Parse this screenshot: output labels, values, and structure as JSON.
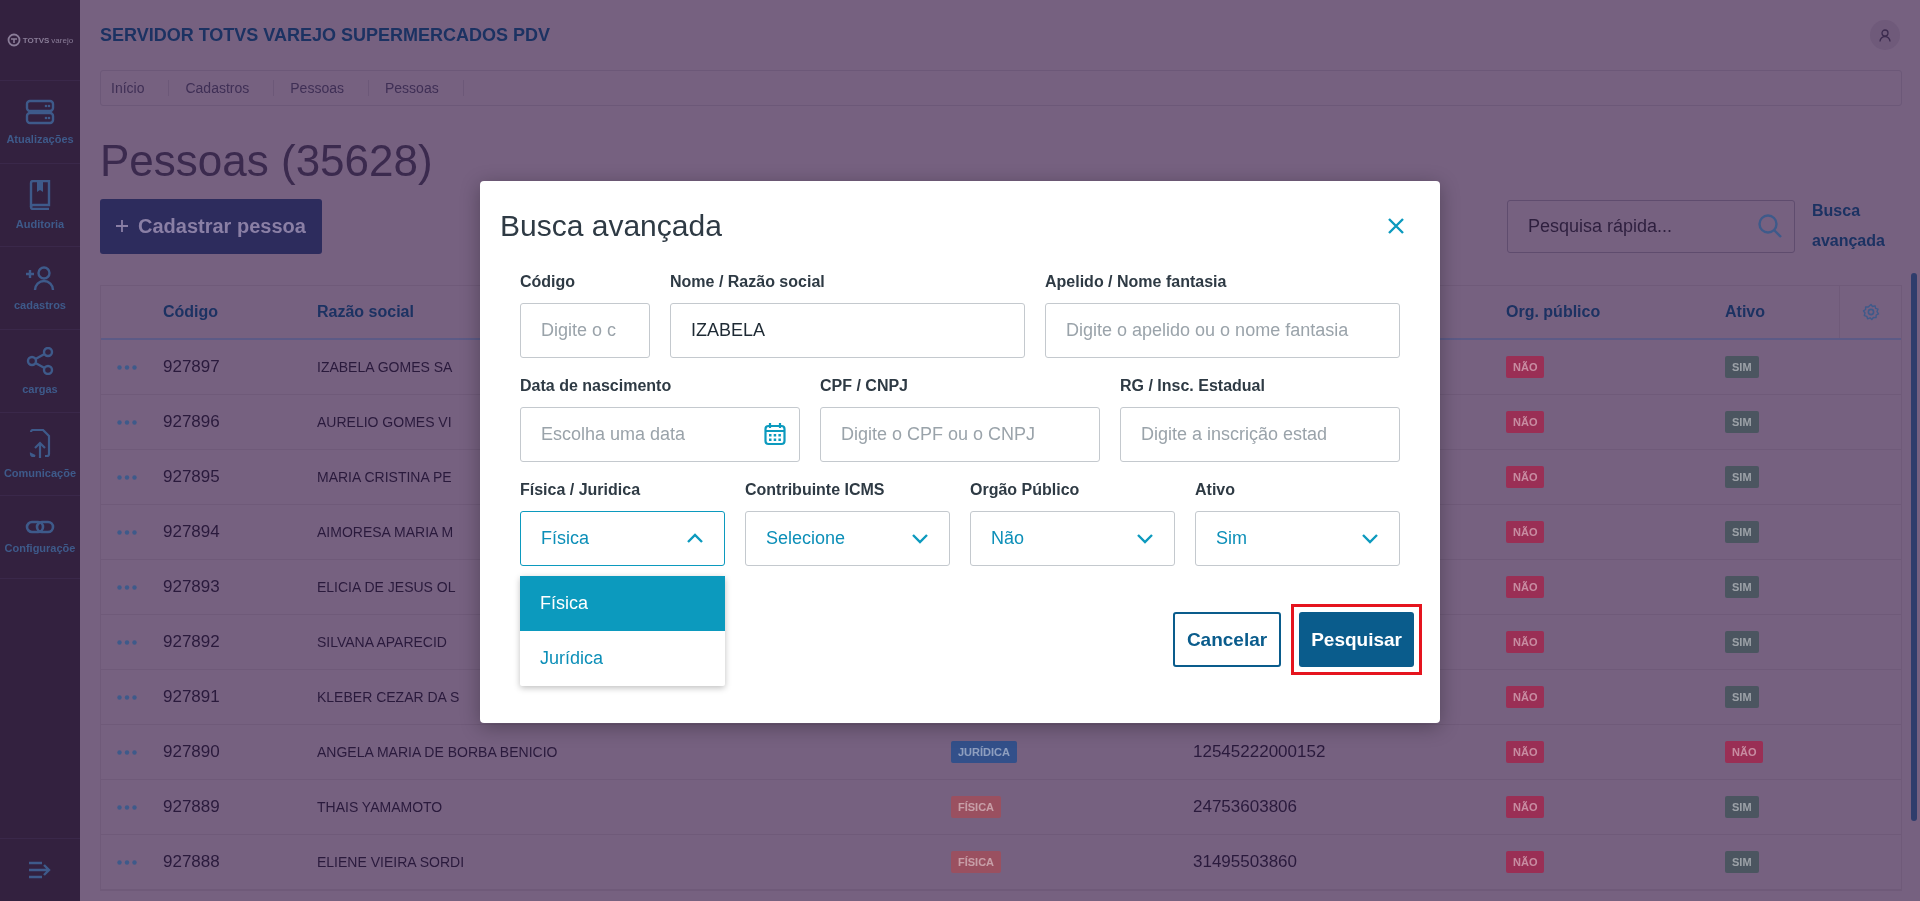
{
  "sidebar": {
    "logo": {
      "brand": "TOTVS",
      "sub": "varejo"
    },
    "items": [
      {
        "label": "Atualizações"
      },
      {
        "label": "Auditoria"
      },
      {
        "label": "cadastros"
      },
      {
        "label": "cargas"
      },
      {
        "label": "Comunicaçõe"
      },
      {
        "label": "Configuraçõe"
      }
    ]
  },
  "header": {
    "title": "SERVIDOR TOTVS VAREJO SUPERMERCADOS PDV"
  },
  "breadcrumb": [
    "Início",
    "Cadastros",
    "Pessoas",
    "Pessoas"
  ],
  "page_title": "Pessoas (35628)",
  "new_button": {
    "label": "Cadastrar pessoa"
  },
  "quick_search": {
    "placeholder": "Pesquisa rápida..."
  },
  "advanced_link": "Busca avançada",
  "table": {
    "columns": [
      "Código",
      "Razão social",
      "Org. público",
      "Ativo"
    ],
    "rows": [
      {
        "code": "927897",
        "name": "IZABELA GOMES SA",
        "org_publico": {
          "label": "NÃO",
          "color": "#9a2f55"
        },
        "ativo": {
          "label": "SIM",
          "color": "#4b5560"
        }
      },
      {
        "code": "927896",
        "name": "AURELIO GOMES VI",
        "org_publico": {
          "label": "NÃO",
          "color": "#9a2f55"
        },
        "ativo": {
          "label": "SIM",
          "color": "#4b5560"
        }
      },
      {
        "code": "927895",
        "name": "MARIA CRISTINA PE",
        "org_publico": {
          "label": "NÃO",
          "color": "#9a2f55"
        },
        "ativo": {
          "label": "SIM",
          "color": "#4b5560"
        }
      },
      {
        "code": "927894",
        "name": "AIMORESA MARIA M",
        "org_publico": {
          "label": "NÃO",
          "color": "#9a2f55"
        },
        "ativo": {
          "label": "SIM",
          "color": "#4b5560"
        }
      },
      {
        "code": "927893",
        "name": "ELICIA DE JESUS OL",
        "org_publico": {
          "label": "NÃO",
          "color": "#9a2f55"
        },
        "ativo": {
          "label": "SIM",
          "color": "#4b5560"
        }
      },
      {
        "code": "927892",
        "name": "SILVANA APARECID",
        "org_publico": {
          "label": "NÃO",
          "color": "#9a2f55"
        },
        "ativo": {
          "label": "SIM",
          "color": "#4b5560"
        }
      },
      {
        "code": "927891",
        "name": "KLEBER CEZAR DA S",
        "org_publico": {
          "label": "NÃO",
          "color": "#9a2f55"
        },
        "ativo": {
          "label": "SIM",
          "color": "#4b5560"
        }
      },
      {
        "code": "927890",
        "name": "ANGELA MARIA DE BORBA BENICIO",
        "type": {
          "label": "JURÍDICA",
          "color": "#33508a"
        },
        "document": "12545222000152",
        "org_publico": {
          "label": "NÃO",
          "color": "#9a2f55"
        },
        "ativo": {
          "label": "NÃO",
          "color": "#9a2f55"
        }
      },
      {
        "code": "927889",
        "name": "THAIS YAMAMOTO",
        "type": {
          "label": "FÍSICA",
          "color": "#9a5060"
        },
        "document": "24753603806",
        "org_publico": {
          "label": "NÃO",
          "color": "#9a2f55"
        },
        "ativo": {
          "label": "SIM",
          "color": "#4b5560"
        }
      },
      {
        "code": "927888",
        "name": "ELIENE VIEIRA SORDI",
        "type": {
          "label": "FÍSICA",
          "color": "#9a5060"
        },
        "document": "31495503860",
        "org_publico": {
          "label": "NÃO",
          "color": "#9a2f55"
        },
        "ativo": {
          "label": "SIM",
          "color": "#4b5560"
        }
      }
    ]
  },
  "modal": {
    "title": "Busca avançada",
    "field_rows": [
      {
        "fields": [
          {
            "kind": "text",
            "label": "Código",
            "placeholder": "Digite o c"
          },
          {
            "kind": "text",
            "label": "Nome / Razão social",
            "value": "IZABELA"
          },
          {
            "kind": "text",
            "label": "Apelido / Nome fantasia",
            "placeholder": "Digite o apelido ou o nome fantasia"
          }
        ]
      },
      {
        "fields": [
          {
            "kind": "date",
            "label": "Data de nascimento",
            "placeholder": "Escolha uma data"
          },
          {
            "kind": "text",
            "label": "CPF / CNPJ",
            "placeholder": "Digite o CPF ou o CNPJ"
          },
          {
            "kind": "text",
            "label": "RG / Insc. Estadual",
            "placeholder": "Digite a inscrição estad"
          }
        ]
      },
      {
        "fields": [
          {
            "kind": "select",
            "label": "Física / Juridica",
            "value": "Física",
            "expanded": true
          },
          {
            "kind": "select",
            "label": "Contribuinte ICMS",
            "value": "Selecione",
            "expanded": false
          },
          {
            "kind": "select",
            "label": "Orgão Público",
            "value": "Não",
            "expanded": false
          },
          {
            "kind": "select",
            "label": "Ativo",
            "value": "Sim",
            "expanded": false
          }
        ]
      }
    ],
    "dropdown": {
      "options": [
        {
          "label": "Física",
          "selected": true
        },
        {
          "label": "Jurídica",
          "selected": false
        }
      ]
    },
    "buttons": [
      {
        "label": "Cancelar",
        "kind": "secondary",
        "highlighted": false
      },
      {
        "label": "Pesquisar",
        "kind": "primary",
        "highlighted": true
      }
    ]
  }
}
